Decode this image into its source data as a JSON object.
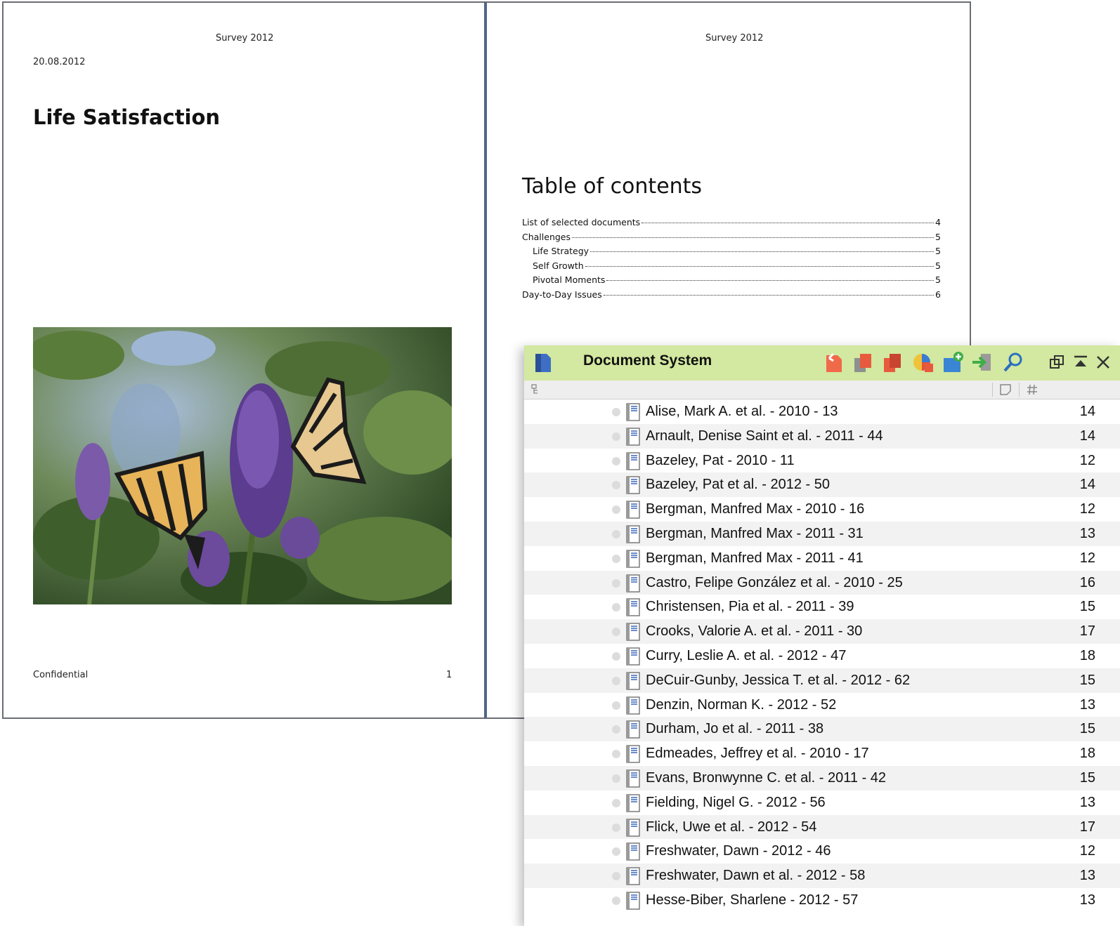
{
  "page1": {
    "header": "Survey 2012",
    "date": "20.08.2012",
    "title": "Life Satisfaction",
    "footer_left": "Confidential",
    "footer_page": "1"
  },
  "page2": {
    "header": "Survey 2012",
    "toc_title": "Table of contents",
    "toc": [
      {
        "label": "List of selected documents",
        "page": "4",
        "level": 1
      },
      {
        "label": "Challenges",
        "page": "5",
        "level": 1
      },
      {
        "label": "Life Strategy",
        "page": "5",
        "level": 2
      },
      {
        "label": "Self Growth",
        "page": "5",
        "level": 2
      },
      {
        "label": "Pivotal Moments",
        "page": "5",
        "level": 2
      },
      {
        "label": "Day-to-Day Issues",
        "page": "6",
        "level": 1
      }
    ]
  },
  "docsys": {
    "title": "Document System",
    "toolbar_icons": [
      "undo-icon",
      "copy-icon",
      "duplicate-icon",
      "chart-icon",
      "new-set-icon",
      "import-icon",
      "search-icon"
    ],
    "window_icons": [
      "undock-icon",
      "collapse-icon",
      "close-icon"
    ],
    "column_icons": [
      "memo-column-icon",
      "count-column-icon"
    ],
    "documents": [
      {
        "name": "Alise, Mark A. et al. - 2010 - 13",
        "count": "14"
      },
      {
        "name": "Arnault, Denise Saint et al. - 2011 - 44",
        "count": "14"
      },
      {
        "name": "Bazeley, Pat - 2010 - 11",
        "count": "12"
      },
      {
        "name": "Bazeley, Pat et al. - 2012 - 50",
        "count": "14"
      },
      {
        "name": "Bergman, Manfred Max - 2010 - 16",
        "count": "12"
      },
      {
        "name": "Bergman, Manfred Max - 2011 - 31",
        "count": "13"
      },
      {
        "name": "Bergman, Manfred Max - 2011 - 41",
        "count": "12"
      },
      {
        "name": "Castro, Felipe González et al. - 2010 - 25",
        "count": "16"
      },
      {
        "name": "Christensen, Pia et al. - 2011 - 39",
        "count": "15"
      },
      {
        "name": "Crooks, Valorie A. et al. - 2011 - 30",
        "count": "17"
      },
      {
        "name": "Curry, Leslie A. et al. - 2012 - 47",
        "count": "18"
      },
      {
        "name": "DeCuir-Gunby, Jessica T. et al. - 2012 - 62",
        "count": "15"
      },
      {
        "name": "Denzin, Norman K. - 2012 - 52",
        "count": "13"
      },
      {
        "name": "Durham, Jo et al. - 2011 - 38",
        "count": "15"
      },
      {
        "name": "Edmeades, Jeffrey et al. - 2010 - 17",
        "count": "18"
      },
      {
        "name": "Evans, Bronwynne C. et al. - 2011 - 42",
        "count": "15"
      },
      {
        "name": "Fielding, Nigel G. - 2012 - 56",
        "count": "13"
      },
      {
        "name": "Flick, Uwe et al. - 2012 - 54",
        "count": "17"
      },
      {
        "name": "Freshwater, Dawn - 2012 - 46",
        "count": "12"
      },
      {
        "name": "Freshwater, Dawn et al. - 2012 - 58",
        "count": "13"
      },
      {
        "name": "Hesse-Biber, Sharlene - 2012 - 57",
        "count": "13"
      }
    ]
  },
  "colors": {
    "titlebar": "#d3e8a0",
    "page_border": "#6b6e74",
    "doc_icon_blue": "#3a66b8",
    "row_alt": "#f2f2f2"
  }
}
